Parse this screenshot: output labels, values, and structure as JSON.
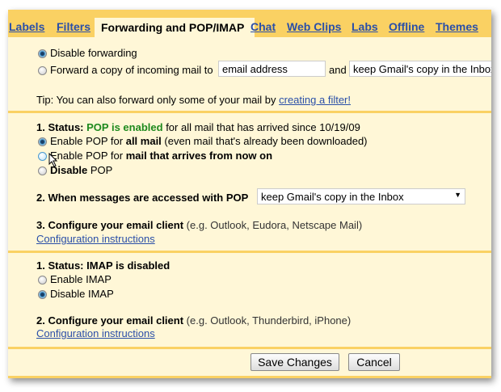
{
  "tabs": [
    "Labels",
    "Filters",
    "Forwarding and POP/IMAP",
    "Chat",
    "Web Clips",
    "Labs",
    "Offline",
    "Themes"
  ],
  "forwarding": {
    "disable_label": "Disable forwarding",
    "forward_label": "Forward a copy of incoming mail to",
    "email_value": "email address",
    "and": "and",
    "action_value": "keep Gmail's copy in the Inbox",
    "tip": "Tip: You can also forward only some of your mail by",
    "tip_link": "creating a filter!"
  },
  "pop": {
    "status_prefix": "1. Status:",
    "status_value": "POP is enabled",
    "status_suffix": "for all mail that has arrived since 10/19/09",
    "opt1_a": "Enable POP for",
    "opt1_b": "all mail",
    "opt1_c": "(even mail that's already been downloaded)",
    "opt2_a": "Enable POP for",
    "opt2_b": "mail that arrives from now on",
    "opt3_a": "Disable",
    "opt3_b": "POP",
    "when_label": "2. When messages are accessed with POP",
    "when_value": "keep Gmail's copy in the Inbox",
    "config_label": "3. Configure your email client",
    "config_hint": "(e.g. Outlook, Eudora, Netscape Mail)",
    "config_link": "Configuration instructions"
  },
  "imap": {
    "status": "1. Status: IMAP is disabled",
    "enable": "Enable IMAP",
    "disable": "Disable IMAP",
    "config_label": "2. Configure your email client",
    "config_hint": "(e.g. Outlook, Thunderbird, iPhone)",
    "config_link": "Configuration instructions"
  },
  "buttons": {
    "save": "Save Changes",
    "cancel": "Cancel"
  }
}
